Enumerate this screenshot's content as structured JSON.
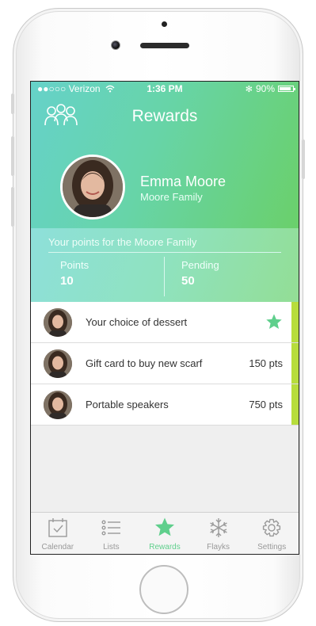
{
  "status_bar": {
    "carrier": "●●○○○ Verizon",
    "wifi": "wifi-icon",
    "time": "1:36 PM",
    "bluetooth": "bluetooth-icon",
    "battery": "90%",
    "battery_level": 0.9
  },
  "nav": {
    "title": "Rewards",
    "left_icon": "family-icon"
  },
  "profile": {
    "name": "Emma Moore",
    "family": "Moore Family"
  },
  "points": {
    "caption": "Your points for the Moore Family",
    "points_label": "Points",
    "points_value": "10",
    "pending_label": "Pending",
    "pending_value": "50"
  },
  "rewards": [
    {
      "title": "Your choice of dessert",
      "points": "",
      "starred": true
    },
    {
      "title": "Gift card to buy new scarf",
      "points": "150 pts",
      "starred": false
    },
    {
      "title": "Portable speakers",
      "points": "750 pts",
      "starred": false
    }
  ],
  "tabs": [
    {
      "label": "Calendar",
      "icon": "calendar-icon",
      "active": false
    },
    {
      "label": "Lists",
      "icon": "list-icon",
      "active": false
    },
    {
      "label": "Rewards",
      "icon": "star-icon",
      "active": true
    },
    {
      "label": "Flayks",
      "icon": "snowflake-icon",
      "active": false
    },
    {
      "label": "Settings",
      "icon": "gear-icon",
      "active": false
    }
  ],
  "colors": {
    "accent": "#5fcf8c",
    "header_start": "#66d2c9",
    "header_end": "#6ad06b",
    "row_accent": "#b7dd3c"
  }
}
